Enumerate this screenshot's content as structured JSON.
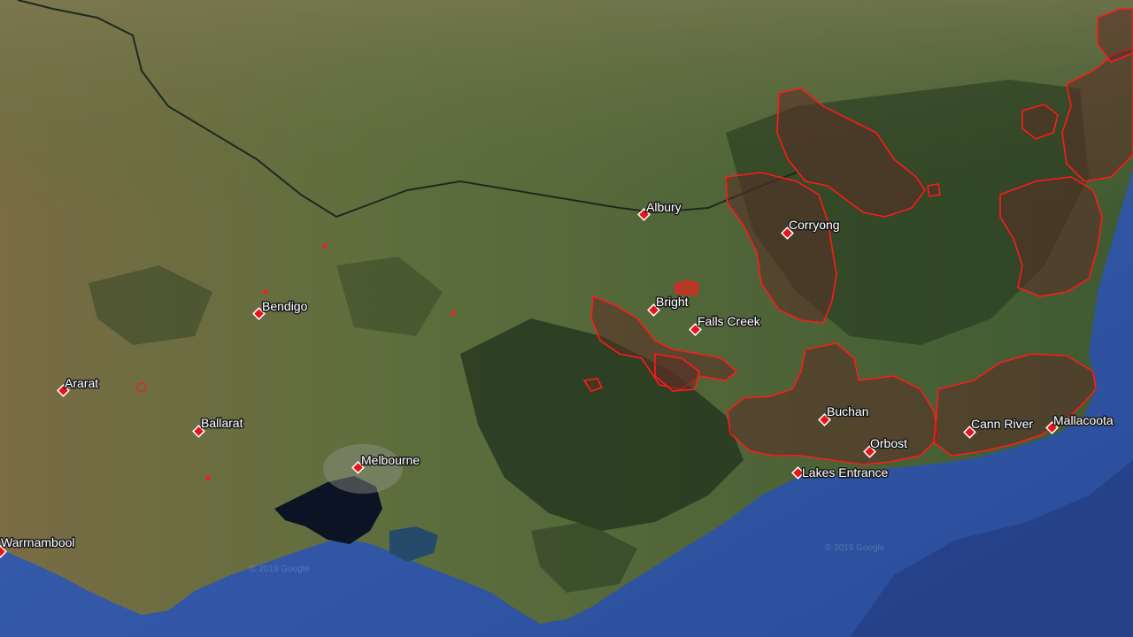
{
  "map": {
    "view": "satellite",
    "colors": {
      "land": "#4e6b3a",
      "land_dry": "#8a7a50",
      "forest": "#25361f",
      "ocean": "#3156a8",
      "bay": "#0b1324",
      "burn_fill": "#5a2e26",
      "burn_outline": "#ff1a1a",
      "marker": "#e8141b"
    },
    "places": [
      {
        "id": "albury",
        "name": "Albury"
      },
      {
        "id": "corryong",
        "name": "Corryong"
      },
      {
        "id": "bright",
        "name": "Bright"
      },
      {
        "id": "falls-creek",
        "name": "Falls Creek"
      },
      {
        "id": "bendigo",
        "name": "Bendigo"
      },
      {
        "id": "ararat",
        "name": "Ararat"
      },
      {
        "id": "ballarat",
        "name": "Ballarat"
      },
      {
        "id": "melbourne",
        "name": "Melbourne"
      },
      {
        "id": "warrnambool",
        "name": "Warrnambool"
      },
      {
        "id": "buchan",
        "name": "Buchan"
      },
      {
        "id": "orbost",
        "name": "Orbost"
      },
      {
        "id": "lakes-entrance",
        "name": "Lakes Entrance"
      },
      {
        "id": "cann-river",
        "name": "Cann River"
      },
      {
        "id": "mallacoota",
        "name": "Mallacoota"
      }
    ],
    "watermarks": [
      "© 2019 Google",
      "© 2019 Google"
    ]
  }
}
